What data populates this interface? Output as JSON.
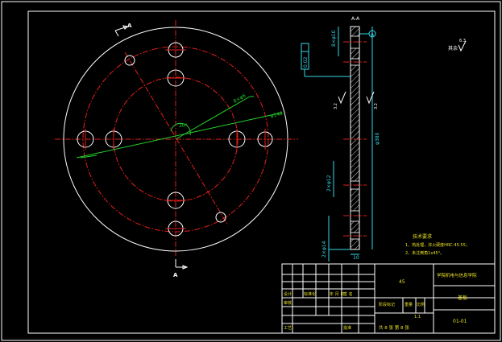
{
  "section_label": "A-A",
  "view_markers": [
    "A",
    "A"
  ],
  "roughness": {
    "label": "其余",
    "value": "6.3"
  },
  "leader_labels": [
    "8×φ6",
    "φ148"
  ],
  "angle_label": "30°",
  "side_view": {
    "dims_left": [
      "8×φ10",
      "2×φ12",
      "2×φ14"
    ],
    "dim_right": "φ380",
    "dim_bottom": "10",
    "datum": "A",
    "flatness_box": "0.02",
    "roughness_marks": [
      "3.2",
      "3.2"
    ]
  },
  "tech_req": {
    "title": "技术要求",
    "items": [
      "1、热处理，淬火硬度HRC-45.55；",
      "2、未注倒角1x45°。"
    ]
  },
  "title_block": {
    "material": "45",
    "school": "学院机电与信息学院",
    "part_name": "盖板",
    "drawing_no": "01-01",
    "scale_label": "比例",
    "scale": "1:1",
    "stage_label": "阶段标记",
    "weight_label": "重量",
    "design_label": "设计",
    "check_label": "审核",
    "process_label": "工艺",
    "approve_label": "批准",
    "sheet_info": "共 8 张 第 8 张",
    "standardization_label": "标准化",
    "date_label": "年 月 日",
    "sign_label": "签 名"
  }
}
